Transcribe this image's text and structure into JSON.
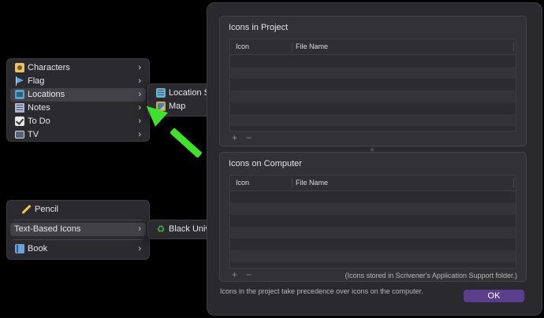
{
  "menus": {
    "categories": {
      "items": [
        {
          "label": "Characters",
          "icon": "character-sheet-icon"
        },
        {
          "label": "Flag",
          "icon": "flag-icon"
        },
        {
          "label": "Locations",
          "icon": "location-icon",
          "selected": true
        },
        {
          "label": "Notes",
          "icon": "notes-icon"
        },
        {
          "label": "To Do",
          "icon": "checkbox-icon"
        },
        {
          "label": "TV",
          "icon": "tv-icon"
        }
      ],
      "chevron": "›"
    },
    "locations_submenu": {
      "items": [
        {
          "label": "Location Sheet",
          "icon": "location-sheet-icon"
        },
        {
          "label": "Map",
          "icon": "map-icon"
        }
      ]
    },
    "second": {
      "items": [
        {
          "label": "Pencil",
          "icon": "pencil-icon"
        },
        {
          "label": "Text-Based Icons",
          "selected": true
        },
        {
          "label": "Book",
          "icon": "book-icon"
        }
      ]
    },
    "text_icons_submenu": {
      "items": [
        {
          "label": "Black Universal Recycling Symbol",
          "icon": "recycling-symbol-icon",
          "glyph": "♻"
        }
      ]
    }
  },
  "annotation": {
    "color": "#3fe12a"
  },
  "dialog": {
    "project_group": {
      "title": "Icons in Project",
      "columns": [
        "Icon",
        "File Name"
      ],
      "add": "+",
      "remove": "−"
    },
    "computer_group": {
      "title": "Icons on Computer",
      "columns": [
        "Icon",
        "File Name"
      ],
      "add": "+",
      "remove": "−",
      "note": "(Icons stored in Scrivener's Application Support folder.)"
    },
    "footer_note": "Icons in the project take precedence over icons on the computer.",
    "ok_label": "OK",
    "accent": "#5b3f8c"
  }
}
